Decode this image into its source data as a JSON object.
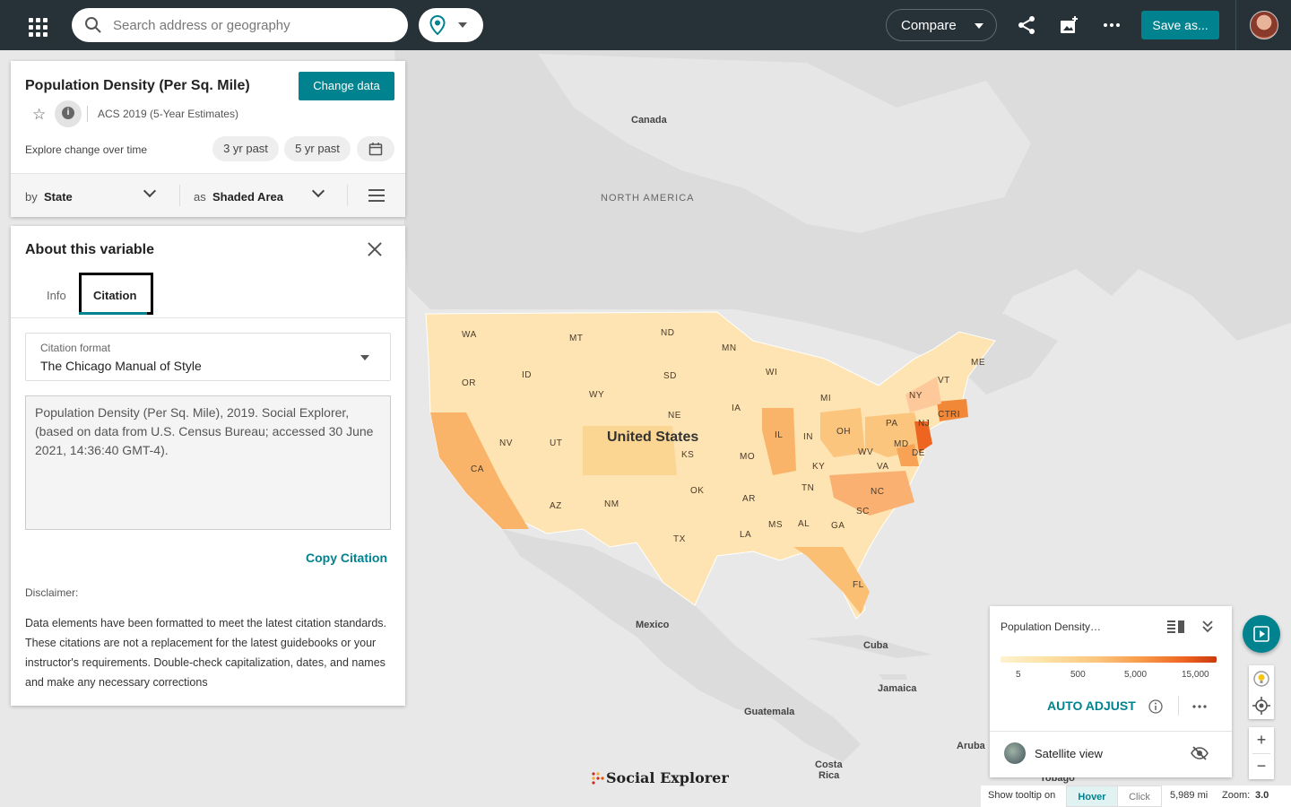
{
  "topbar": {
    "search_placeholder": "Search address or geography",
    "compare_label": "Compare",
    "save_label": "Save as..."
  },
  "data_panel": {
    "title": "Population Density (Per Sq. Mile)",
    "change_data_label": "Change data",
    "survey": "ACS 2019 (5-Year Estimates)",
    "explore_label": "Explore change over time",
    "pill_3yr": "3 yr past",
    "pill_5yr": "5 yr past",
    "by_prefix": "by",
    "by_value": "State",
    "as_prefix": "as",
    "as_value": "Shaded Area"
  },
  "about": {
    "title": "About this variable",
    "tabs": [
      "Info",
      "Citation"
    ],
    "active_tab": "Citation",
    "citation_format_label": "Citation format",
    "citation_format_value": "The Chicago Manual of Style",
    "citation_text": "Population Density (Per Sq. Mile), 2019. Social Explorer, (based on data from U.S. Census Bureau; accessed 30 June 2021, 14:36:40 GMT-4).",
    "copy_label": "Copy Citation",
    "disclaimer_label": "Disclaimer:",
    "disclaimer_text": "Data elements have been formatted to meet the latest citation standards. These citations are not a replacement for the latest guidebooks or your instructor's requirements. Double-check capitalization, dates, and names and make any necessary corrections"
  },
  "map": {
    "labels": {
      "canada": "Canada",
      "north_america": "NORTH AMERICA",
      "united_states": "United States",
      "mexico": "Mexico",
      "cuba": "Cuba",
      "jamaica": "Jamaica",
      "guatemala": "Guatemala",
      "costa": "Costa",
      "rica": "Rica",
      "aruba": "Aruba",
      "tobago": "Tobago"
    },
    "states": [
      "WA",
      "MT",
      "ND",
      "MN",
      "ME",
      "VT",
      "OR",
      "ID",
      "SD",
      "WI",
      "MI",
      "NY",
      "CT",
      "RI",
      "WY",
      "IA",
      "NE",
      "PA",
      "NJ",
      "NV",
      "UT",
      "IL",
      "IN",
      "OH",
      "MD",
      "DE",
      "KS",
      "MO",
      "WV",
      "KY",
      "VA",
      "CA",
      "OK",
      "TN",
      "NC",
      "AR",
      "SC",
      "AZ",
      "NM",
      "MS",
      "AL",
      "GA",
      "TX",
      "LA",
      "FL"
    ]
  },
  "legend": {
    "title": "Population Density…",
    "ticks": [
      "5",
      "500",
      "5,000",
      "15,000"
    ],
    "auto_adjust": "AUTO ADJUST",
    "satellite": "Satellite view"
  },
  "status": {
    "tooltip_label": "Show tooltip on",
    "hover": "Hover",
    "click": "Click",
    "scale": "5,989 mi",
    "zoom_label": "Zoom:",
    "zoom_value": "3.0"
  },
  "brand": "Social Explorer",
  "colors": {
    "accent": "#00838f",
    "topbar": "#263238"
  }
}
